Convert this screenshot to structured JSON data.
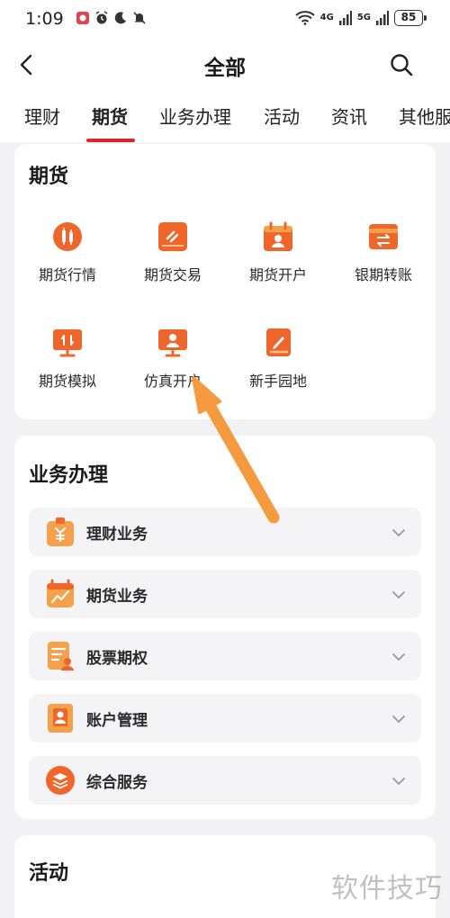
{
  "status_bar": {
    "time": "1:09",
    "network_1": "4G",
    "network_2": "5G",
    "battery": "85"
  },
  "header": {
    "title": "全部"
  },
  "tabs": [
    "理财",
    "期货",
    "业务办理",
    "活动",
    "资讯",
    "其他服"
  ],
  "active_tab": "期货",
  "futures": {
    "title": "期货",
    "items": [
      {
        "label": "期货行情",
        "icon": "futures-quote-icon"
      },
      {
        "label": "期货交易",
        "icon": "futures-trade-icon"
      },
      {
        "label": "期货开户",
        "icon": "futures-account-open-icon"
      },
      {
        "label": "银期转账",
        "icon": "bank-transfer-icon"
      },
      {
        "label": "期货模拟",
        "icon": "futures-simulation-icon"
      },
      {
        "label": "仿真开户",
        "icon": "simulation-account-icon"
      },
      {
        "label": "新手园地",
        "icon": "beginner-guide-icon"
      }
    ]
  },
  "business": {
    "title": "业务办理",
    "rows": [
      {
        "label": "理财业务",
        "icon": "wealth-bag-icon"
      },
      {
        "label": "期货业务",
        "icon": "futures-chart-icon"
      },
      {
        "label": "股票期权",
        "icon": "stock-option-icon"
      },
      {
        "label": "账户管理",
        "icon": "account-card-icon"
      },
      {
        "label": "综合服务",
        "icon": "layers-icon"
      }
    ]
  },
  "activity": {
    "title": "活动"
  },
  "watermark": "软件技巧",
  "colors": {
    "accent": "#d9262b",
    "icon_orange": "#f0652a",
    "icon_light": "#f5a04a",
    "arrow": "#f59a3e"
  }
}
